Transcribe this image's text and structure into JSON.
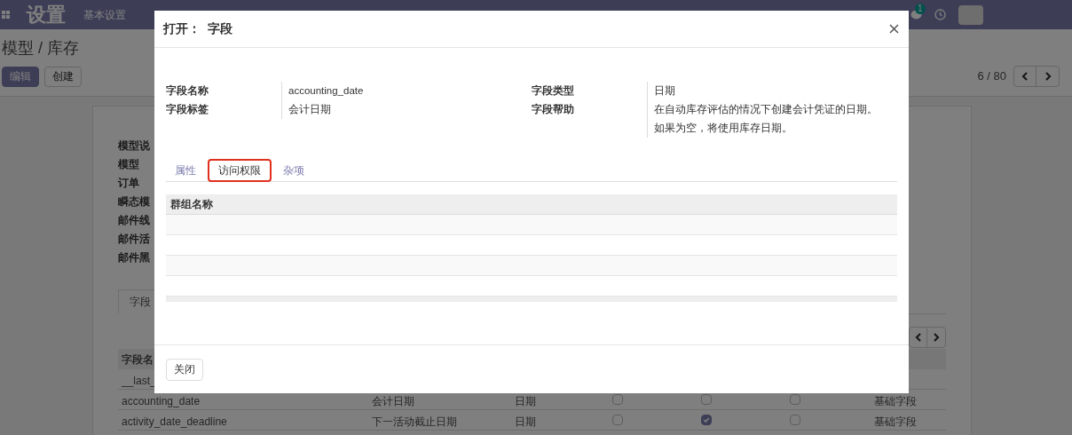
{
  "navbar": {
    "app_title": "设置",
    "menu": [
      "基本设置"
    ],
    "chat_badge": "1"
  },
  "breadcrumb": "模型 / 库存",
  "buttons": [
    {
      "label": "编辑",
      "kind": "primary"
    },
    {
      "label": "创建",
      "kind": "secondary"
    }
  ],
  "pager": "6 / 80",
  "sheet": {
    "labels": [
      "模型说",
      "模型",
      "订单",
      "瞬态模",
      "邮件线",
      "邮件活",
      "邮件黑"
    ],
    "tabs": [
      {
        "label": "字段",
        "selected": true
      }
    ],
    "table": {
      "header": "字段名",
      "rows": [
        {
          "cells": [
            "__last_"
          ]
        },
        {
          "cells": [
            "accounting_date",
            "会计日期",
            "日期"
          ],
          "checks": [
            false,
            false,
            false
          ],
          "kind_label": "基础字段"
        },
        {
          "cells": [
            "activity_date_deadline",
            "下一活动截止日期",
            "日期"
          ],
          "checks": [
            false,
            true,
            false
          ],
          "kind_label": "基础字段"
        }
      ]
    }
  },
  "dialog": {
    "title": "打开：  字段",
    "fields": [
      {
        "label": "字段名称",
        "value": "accounting_date"
      },
      {
        "label": "字段标签",
        "value": "会计日期"
      },
      {
        "label": "字段类型",
        "value": "日期"
      },
      {
        "label": "字段帮助",
        "value": [
          "在自动库存评估的情况下创建会计凭证的日期。",
          "如果为空，将使用库存日期。"
        ]
      }
    ],
    "tabs": [
      {
        "label": "属性",
        "selected": false
      },
      {
        "label": "访问权限",
        "selected": true
      },
      {
        "label": "杂项",
        "selected": false
      }
    ],
    "table": {
      "columns": [
        "群组名称"
      ]
    },
    "close_button": "关闭"
  }
}
